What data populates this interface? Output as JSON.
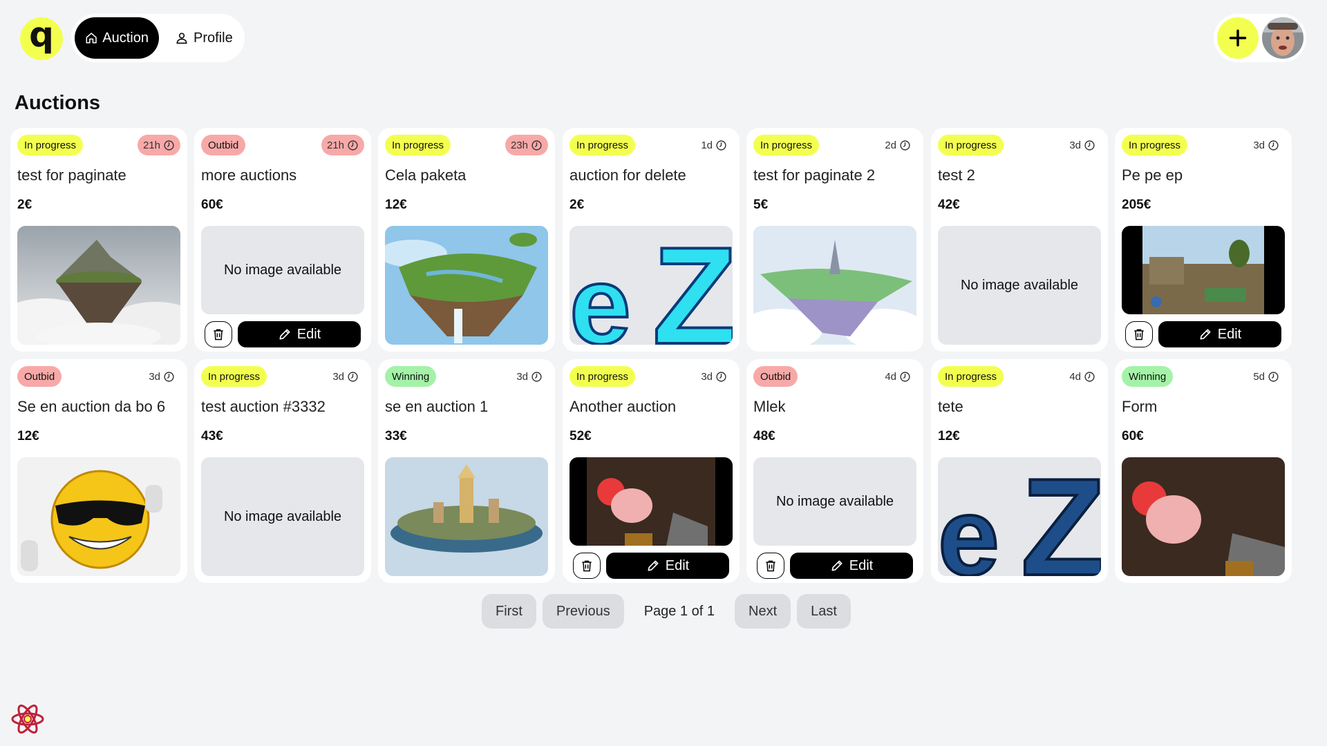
{
  "nav": {
    "logo": "q",
    "items": [
      {
        "label": "Auction",
        "active": true
      },
      {
        "label": "Profile",
        "active": false
      }
    ]
  },
  "page_title": "Auctions",
  "auctions": [
    {
      "status": "In progress",
      "time": "21h",
      "title": "test for paginate",
      "price": "2€",
      "image": "floating-island-clouds",
      "owned": false
    },
    {
      "status": "Outbid",
      "time": "21h",
      "title": "more auctions",
      "price": "60€",
      "image": null,
      "owned": true
    },
    {
      "status": "In progress",
      "time": "23h",
      "title": "Cela paketa",
      "price": "12€",
      "image": "floating-island-green",
      "owned": false
    },
    {
      "status": "In progress",
      "time": "1d",
      "title": "auction for delete",
      "price": "2€",
      "image": "ez-logo-cyan",
      "owned": false
    },
    {
      "status": "In progress",
      "time": "2d",
      "title": "test for paginate 2",
      "price": "5€",
      "image": "floating-island-anime",
      "owned": false
    },
    {
      "status": "In progress",
      "time": "3d",
      "title": "test 2",
      "price": "42€",
      "image": null,
      "owned": false
    },
    {
      "status": "In progress",
      "time": "3d",
      "title": "Pe pe ep",
      "price": "205€",
      "image": "game-screenshot",
      "owned": true
    },
    {
      "status": "Outbid",
      "time": "3d",
      "title": "Se en auction da bo 6",
      "price": "12€",
      "image": "cool-emoji",
      "owned": false
    },
    {
      "status": "In progress",
      "time": "3d",
      "title": "test auction #3332",
      "price": "43€",
      "image": null,
      "owned": false
    },
    {
      "status": "Winning",
      "time": "3d",
      "title": "se en auction 1",
      "price": "33€",
      "image": "floating-city",
      "owned": false
    },
    {
      "status": "In progress",
      "time": "3d",
      "title": "Another auction",
      "price": "52€",
      "image": "quake-screenshot",
      "owned": true
    },
    {
      "status": "Outbid",
      "time": "4d",
      "title": "Mlek",
      "price": "48€",
      "image": null,
      "owned": true
    },
    {
      "status": "In progress",
      "time": "4d",
      "title": "tete",
      "price": "12€",
      "image": "ez-logo-blue",
      "owned": false
    },
    {
      "status": "Winning",
      "time": "5d",
      "title": "Form",
      "price": "60€",
      "image": "quake-screenshot-2",
      "owned": false
    }
  ],
  "labels": {
    "no_image": "No image available",
    "edit": "Edit"
  },
  "pagination": {
    "first": "First",
    "previous": "Previous",
    "page_info": "Page 1 of 1",
    "next": "Next",
    "last": "Last"
  },
  "colors": {
    "accent": "#f3ff4f",
    "outbid": "#f7a9a8",
    "winning": "#a4f2a7",
    "background": "#f3f4f6"
  }
}
